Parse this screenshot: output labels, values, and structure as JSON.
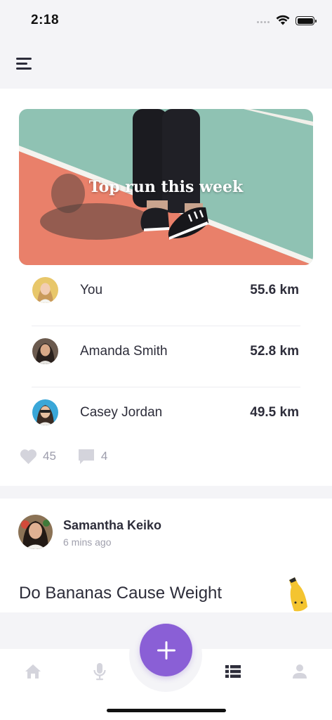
{
  "status_bar": {
    "time": "2:18"
  },
  "nav": {
    "menu_icon": "hamburger-menu-icon"
  },
  "top_run_card": {
    "hero_title": "Top run this week",
    "ranking": [
      {
        "name": "You",
        "distance": "55.6 km"
      },
      {
        "name": "Amanda Smith",
        "distance": "52.8 km"
      },
      {
        "name": "Casey Jordan",
        "distance": "49.5 km"
      }
    ],
    "likes": "45",
    "comments": "4"
  },
  "post_card": {
    "author": "Samantha Keiko",
    "time": "6 mins ago",
    "title": "Do Bananas Cause Weight"
  },
  "tab_bar": {
    "tabs": [
      "home-icon",
      "microphone-icon",
      "list-icon",
      "profile-icon"
    ],
    "fab_icon": "plus-icon",
    "active_tab": "list-icon"
  },
  "colors": {
    "accent": "#8a5fd6",
    "court_green": "#8fc2b3",
    "court_red": "#e9806a",
    "text_primary": "#2d2d3a",
    "text_muted": "#9c9cab"
  }
}
